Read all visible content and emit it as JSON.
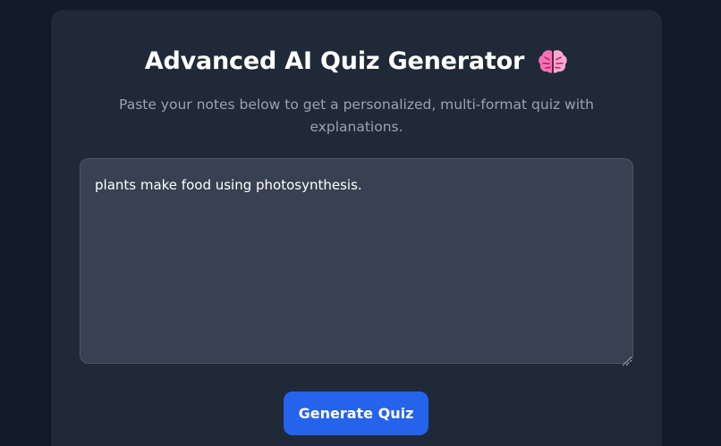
{
  "header": {
    "title": "Advanced AI Quiz Generator",
    "title_icon": "brain-icon",
    "subtitle": "Paste your notes below to get a personalized, multi-format quiz with explanations."
  },
  "notes_input": {
    "value": "plants make food using photosynthesis."
  },
  "actions": {
    "generate_label": "Generate Quiz"
  },
  "colors": {
    "background": "#131a27",
    "card": "#1f2937",
    "input": "#374151",
    "accent": "#2563eb",
    "subtitle": "#9ca3af"
  }
}
